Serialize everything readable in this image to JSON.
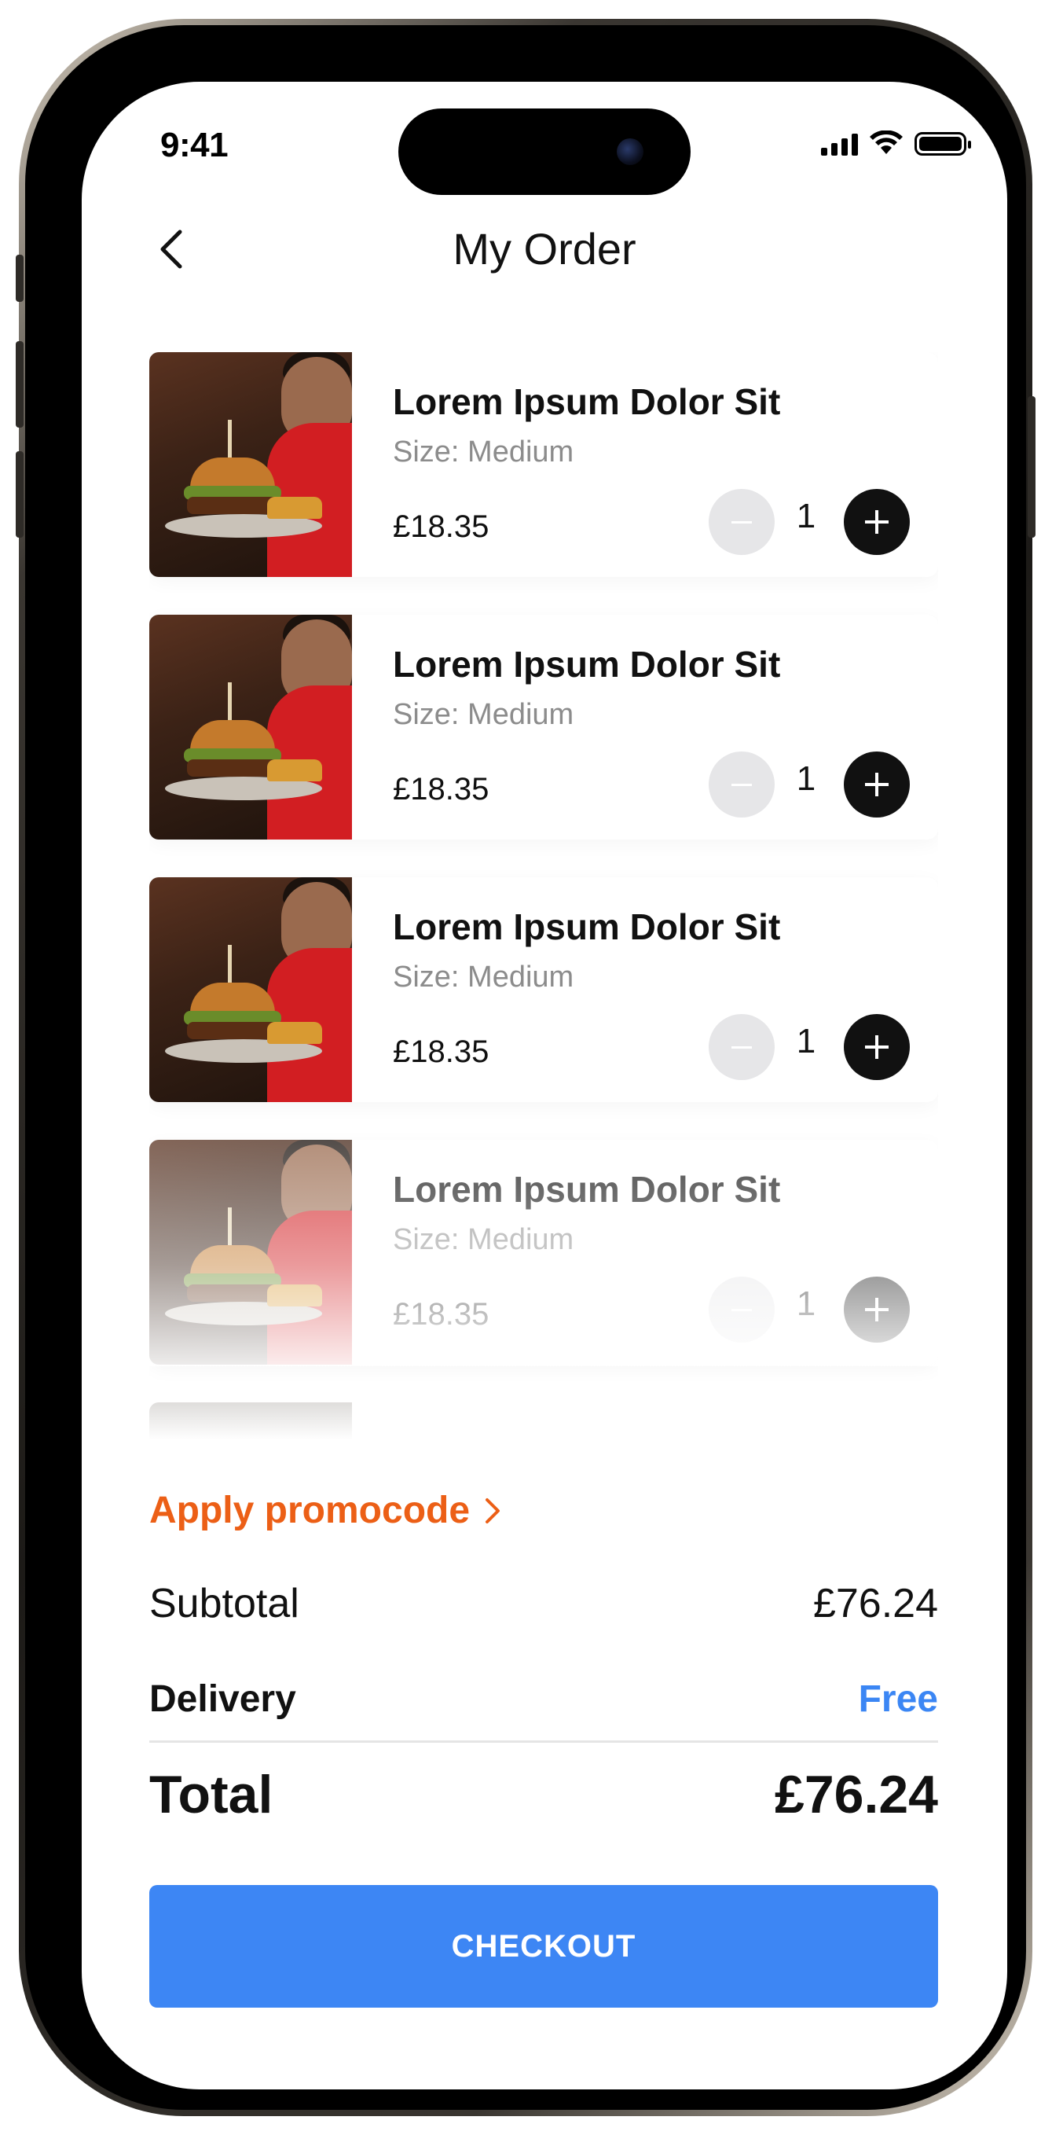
{
  "status_bar": {
    "time": "9:41",
    "icons": [
      "cellular-signal-icon",
      "wifi-icon",
      "battery-icon"
    ]
  },
  "header": {
    "title": "My Order",
    "back_icon": "chevron-left-icon"
  },
  "order_items": [
    {
      "title": "Lorem Ipsum Dolor Sit",
      "size": "Size: Medium",
      "price": "£18.35",
      "quantity": "1"
    },
    {
      "title": "Lorem Ipsum Dolor Sit",
      "size": "Size: Medium",
      "price": "£18.35",
      "quantity": "1"
    },
    {
      "title": "Lorem Ipsum Dolor Sit",
      "size": "Size: Medium",
      "price": "£18.35",
      "quantity": "1"
    },
    {
      "title": "Lorem Ipsum Dolor Sit",
      "size": "Size: Medium",
      "price": "£18.35",
      "quantity": "1"
    }
  ],
  "promo": {
    "label": "Apply promocode",
    "icon": "chevron-right-icon"
  },
  "summary": {
    "subtotal_label": "Subtotal",
    "subtotal_value": "£76.24",
    "delivery_label": "Delivery",
    "delivery_value": "Free",
    "total_label": "Total",
    "total_value": "£76.24"
  },
  "checkout": {
    "label": "CHECKOUT"
  },
  "colors": {
    "accent_orange": "#ec5f16",
    "primary_blue": "#3d86f4",
    "free_blue": "#3b86f4",
    "text_dark": "#111111",
    "text_muted": "#8c8c8c"
  }
}
